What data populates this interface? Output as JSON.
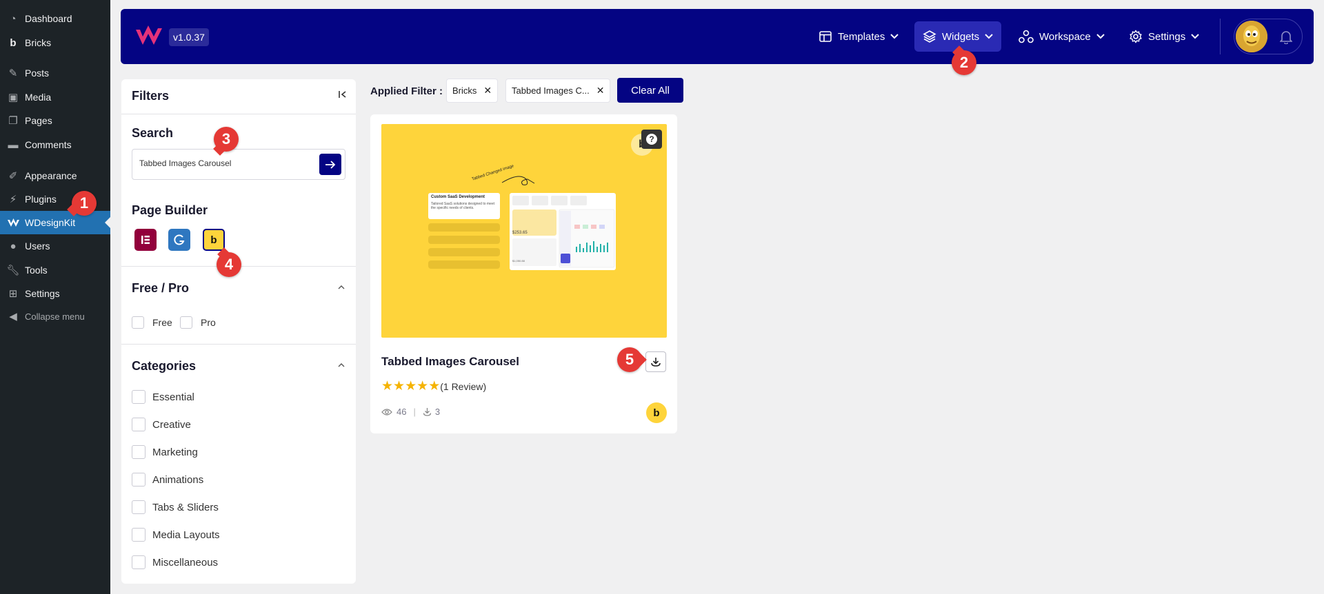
{
  "wp_menu": [
    {
      "label": "Dashboard",
      "icon": "dashboard-icon"
    },
    {
      "label": "Bricks",
      "icon": "bricks-icon"
    },
    {
      "label": "Posts",
      "icon": "pin-icon"
    },
    {
      "label": "Media",
      "icon": "media-icon"
    },
    {
      "label": "Pages",
      "icon": "pages-icon"
    },
    {
      "label": "Comments",
      "icon": "comments-icon"
    },
    {
      "label": "Appearance",
      "icon": "brush-icon"
    },
    {
      "label": "Plugins",
      "icon": "plug-icon"
    },
    {
      "label": "WDesignKit",
      "icon": "wdesignkit-icon",
      "active": true
    },
    {
      "label": "Users",
      "icon": "user-icon"
    },
    {
      "label": "Tools",
      "icon": "wrench-icon"
    },
    {
      "label": "Settings",
      "icon": "settings-icon"
    },
    {
      "label": "Collapse menu",
      "icon": "collapse-icon"
    }
  ],
  "header": {
    "version": "v1.0.37",
    "nav": [
      {
        "label": "Templates",
        "icon": "templates-icon"
      },
      {
        "label": "Widgets",
        "icon": "layers-icon",
        "active": true
      },
      {
        "label": "Workspace",
        "icon": "workspace-icon"
      },
      {
        "label": "Settings",
        "icon": "gear-icon"
      }
    ]
  },
  "markers": [
    "1",
    "2",
    "3",
    "4",
    "5"
  ],
  "filters": {
    "title": "Filters",
    "search": {
      "heading": "Search",
      "value": "Tabbed Images Carousel"
    },
    "page_builder": {
      "heading": "Page Builder",
      "builders": [
        "elementor",
        "gutenberg",
        "bricks"
      ],
      "selected": "bricks"
    },
    "free_pro": {
      "heading": "Free / Pro",
      "options": [
        "Free",
        "Pro"
      ]
    },
    "categories": {
      "heading": "Categories",
      "options": [
        "Essential",
        "Creative",
        "Marketing",
        "Animations",
        "Tabs & Sliders",
        "Media Layouts",
        "Miscellaneous"
      ]
    }
  },
  "applied": {
    "label": "Applied Filter :",
    "chips": [
      "Bricks",
      "Tabbed Images C..."
    ],
    "clear_label": "Clear All"
  },
  "card": {
    "title": "Tabbed Images Carousel",
    "rating": 5,
    "reviews": "(1 Review)",
    "views": "46",
    "downloads": "3",
    "builder_badge": "b",
    "thumb": {
      "annotation": "Tabbed Changed image",
      "panel_title": "Custom SaaS Development",
      "panel_text": "Tailored SaaS solutions designed to meet the specific needs of clients."
    }
  },
  "colors": {
    "brand": "#040483",
    "wp_sidebar": "#1d2327",
    "wp_active": "#2271b1",
    "marker": "#e53935",
    "bricks_yellow": "#fed43b"
  }
}
